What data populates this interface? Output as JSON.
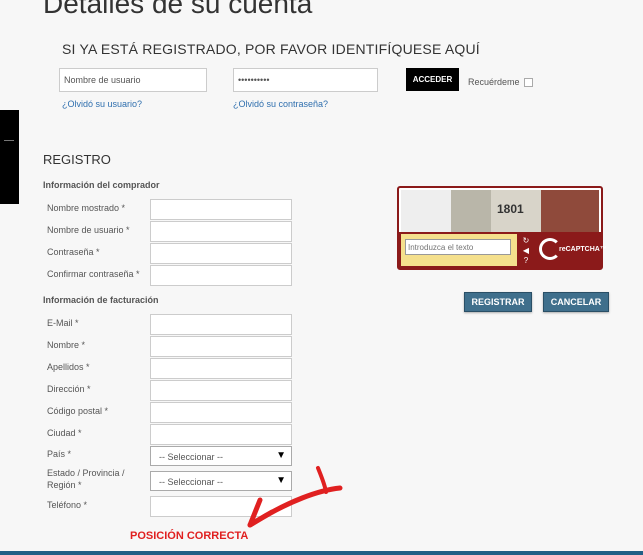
{
  "page": {
    "title": "Detalles de su cuenta"
  },
  "login": {
    "heading": "SI YA ESTÁ REGISTRADO, POR FAVOR IDENTIFÍQUESE AQUÍ",
    "username_placeholder": "Nombre de usuario",
    "password_value": "••••••••••",
    "submit_label": "ACCEDER",
    "remember_label": "Recuérdeme",
    "forgot_username": "¿Olvidó su usuario?",
    "forgot_password": "¿Olvidó su contraseña?"
  },
  "register": {
    "heading": "REGISTRO",
    "buyer_section": "Información del comprador",
    "buyer_fields": [
      "Nombre mostrado *",
      "Nombre de usuario *",
      "Contraseña *",
      "Confirmar contraseña *"
    ],
    "billing_section": "Información de facturación",
    "billing_fields": [
      "E-Mail *",
      "Nombre *",
      "Apellidos *",
      "Dirección *",
      "Código postal *",
      "Ciudad *"
    ],
    "country_label": "País *",
    "state_label_line1": "Estado / Provincia /",
    "state_label_line2": "Región *",
    "phone_label": "Teléfono *",
    "select_placeholder": "-- Seleccionar --",
    "register_button": "REGISTRAR",
    "cancel_button": "CANCELAR"
  },
  "captcha": {
    "input_placeholder": "Introduzca el texto",
    "word": "1801",
    "logo_text": "reCAPTCHA™"
  },
  "annotation": {
    "text": "POSICIÓN CORRECTA",
    "color": "#e02020"
  },
  "icons": {
    "refresh": "refresh-icon",
    "audio": "audio-icon",
    "help": "help-icon",
    "dropdown": "chevron-down-icon"
  }
}
